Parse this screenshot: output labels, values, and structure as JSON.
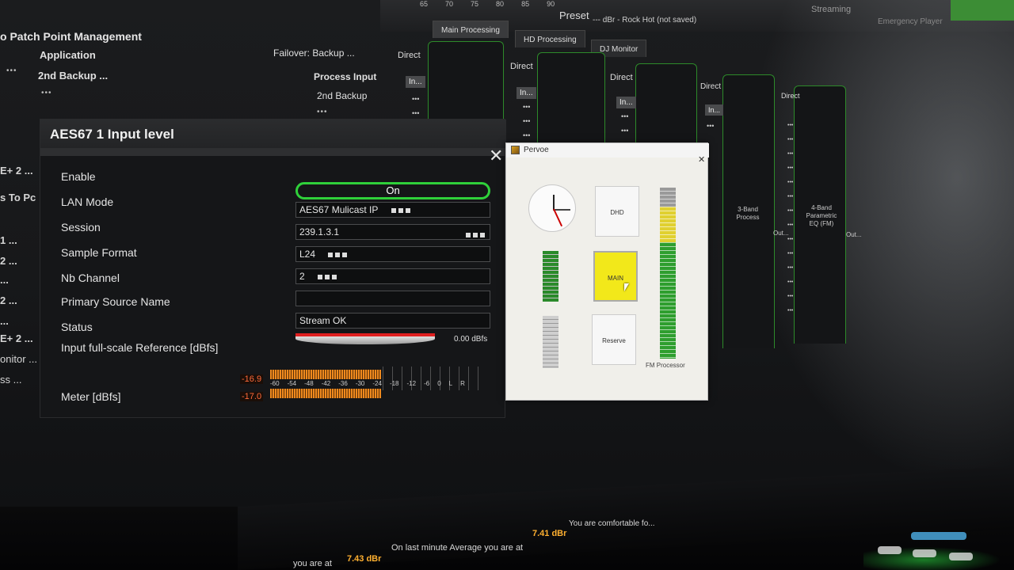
{
  "background": {
    "patch_title": "o Patch Point Management",
    "rows": [
      {
        "label": "Application"
      },
      {
        "label": "2nd Backup ..."
      }
    ],
    "failover": "Failover: Backup ...",
    "process_input": "Process Input",
    "second_backup": "2nd Backup",
    "side_labels": [
      "E+ 2 ...",
      "s To Pc",
      "1 ...",
      "2 ...",
      "...",
      "2 ...",
      "...",
      "E+ 2 ...",
      "onitor ...",
      "ss ..."
    ],
    "vu_scale": [
      "65",
      "70",
      "75",
      "80",
      "85",
      "90"
    ],
    "preset_label": "Preset",
    "preset_value": "--- dBr - Rock Hot (not saved)",
    "tab_streaming": "Streaming",
    "tab_emergency": "Emergency Player",
    "proc_tabs": [
      "Main Processing",
      "HD Processing",
      "DJ Monitor"
    ],
    "direct_label": "Direct",
    "in_label": "In...",
    "proc_labels": [
      "3-Band Process",
      "4-Band Parametric EQ (FM)"
    ],
    "out_label": "Out..."
  },
  "aes_dialog": {
    "title": "AES67 1 Input level",
    "close_icon": "close-icon",
    "fields": {
      "enable_label": "Enable",
      "enable_value": "On",
      "lan_label": "LAN Mode",
      "lan_value": "AES67 Mulicast IP",
      "session_label": "Session",
      "session_value": "239.1.3.1",
      "sample_label": "Sample Format",
      "sample_value": "L24",
      "nb_label": "Nb Channel",
      "nb_value": "2",
      "primary_label": "Primary Source Name",
      "primary_value": "",
      "status_label": "Status",
      "status_value": "Stream OK",
      "ref_label": "Input full-scale Reference [dBfs]",
      "ref_value": "0.00 dBfs",
      "meter_label": "Meter [dBfs]"
    },
    "meter": {
      "ch1": "-16.9",
      "ch2": "-17.0",
      "scale": [
        "-60",
        "-54",
        "-48",
        "-42",
        "-36",
        "-30",
        "-24",
        "-18",
        "-12",
        "-6",
        "0",
        "L",
        "R"
      ]
    }
  },
  "pervoe": {
    "title": "Pervoe",
    "buttons": {
      "dhd": "DHD",
      "main": "MAIN",
      "reserve": "Reserve"
    },
    "fm_label": "FM Processor",
    "main_color": "#f2e81a"
  },
  "status_bar": {
    "prefix": "you are at",
    "value1": "7.43 dBr",
    "mid": "On last minute Average you are at",
    "value2": "7.41 dBr",
    "suffix": "You are comfortable fo..."
  }
}
